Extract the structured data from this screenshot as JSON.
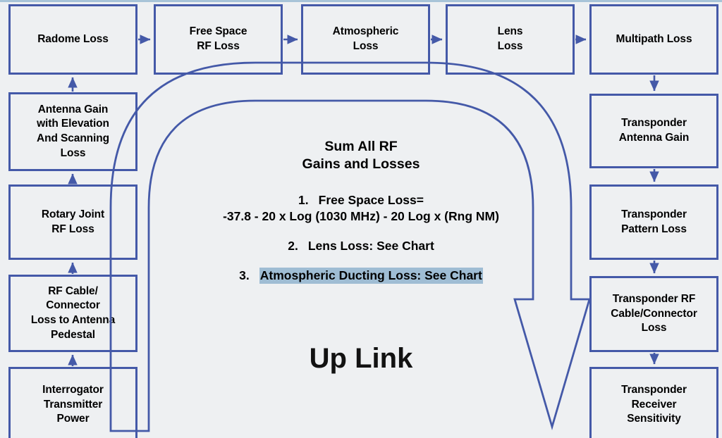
{
  "diagram": {
    "title": "Up Link RF Gain and Loss Budget Flow",
    "center_label": "Up Link",
    "colors": {
      "border": "#4459a8",
      "node_fill": "#eef0f2",
      "background": "#eef0f2",
      "highlight": "#9fbdd4",
      "top_band": "#a8c4d8",
      "text": "#000000"
    },
    "top_row": [
      {
        "id": "radome-loss",
        "label": "Radome Loss"
      },
      {
        "id": "free-space-rf-loss",
        "label": "Free Space\nRF Loss"
      },
      {
        "id": "atmospheric-loss",
        "label": "Atmospheric\nLoss"
      },
      {
        "id": "lens-loss",
        "label": "Lens\nLoss"
      },
      {
        "id": "multipath-loss",
        "label": "Multipath Loss"
      }
    ],
    "left_column": [
      {
        "id": "antenna-gain-elevation-scanning-loss",
        "label": "Antenna Gain\nwith Elevation\nAnd Scanning\nLoss"
      },
      {
        "id": "rotary-joint-rf-loss",
        "label": "Rotary Joint\nRF Loss"
      },
      {
        "id": "rf-cable-connector-loss-to-antenna-pedestal",
        "label": "RF Cable/\nConnector\nLoss to Antenna\nPedestal"
      },
      {
        "id": "interrogator-transmitter-power",
        "label": "Interrogator\nTransmitter\nPower"
      }
    ],
    "right_column": [
      {
        "id": "transponder-antenna-gain",
        "label": "Transponder\nAntenna Gain"
      },
      {
        "id": "transponder-pattern-loss",
        "label": "Transponder\nPattern Loss"
      },
      {
        "id": "transponder-rf-cable-connector-loss",
        "label": "Transponder RF\nCable/Connector\nLoss"
      },
      {
        "id": "transponder-receiver-sensitivity",
        "label": "Transponder\nReceiver\nSensitivity"
      }
    ],
    "center_panel": {
      "heading": "Sum All RF\nGains and Losses",
      "items": [
        {
          "number": "1.",
          "text": "Free Space Loss=",
          "formula": "-37.8 - 20 x Log (1030 MHz) - 20 Log x (Rng NM)",
          "highlighted": false
        },
        {
          "number": "2.",
          "text": "Lens Loss: See Chart",
          "highlighted": false
        },
        {
          "number": "3.",
          "text": "Atmospheric Ducting Loss: See Chart",
          "highlighted": true
        }
      ]
    }
  }
}
